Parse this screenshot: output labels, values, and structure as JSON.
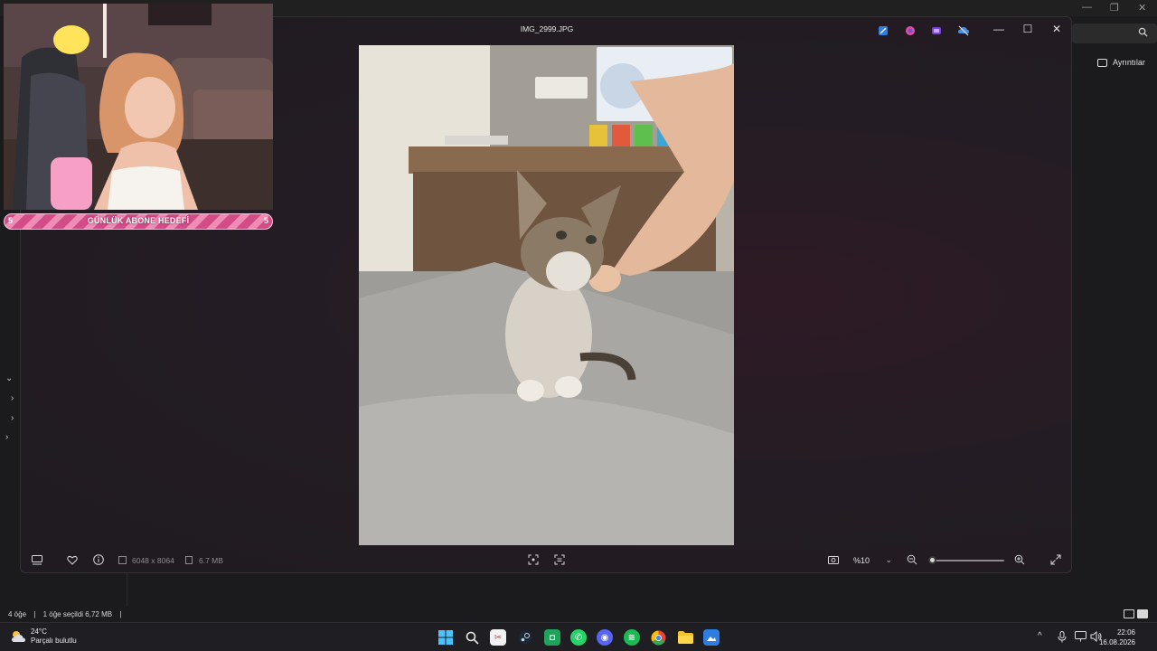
{
  "explorer": {
    "window_controls": {
      "minimize": "—",
      "maximize": "❐",
      "close": "✕"
    },
    "search_icon": "search-icon",
    "details_label": "Ayrıntılar",
    "nav_chevrons": [
      "⌄",
      "›",
      "›",
      "›"
    ],
    "status": {
      "item_count": "4 öğe",
      "separator": "|",
      "selected": "1 öğe seçildi  6,72 MB",
      "end_separator": "|"
    }
  },
  "photos": {
    "title": "IMG_2999.JPG",
    "window_controls": {
      "minimize": "—",
      "maximize": "☐",
      "close": "✕"
    },
    "toolbar": {
      "dimensions": "6048 x 8064",
      "file_size": "6.7 MB",
      "zoom": "%10",
      "zoom_chevron": "⌄",
      "zoom_level": 0.02
    }
  },
  "webcam": {
    "goal_label": "GÜNLÜK ABONE HEDEFİ",
    "goal_current": "5",
    "goal_target": "5"
  },
  "taskbar": {
    "weather": {
      "temp": "24°C",
      "condition": "Parçalı bulutlu"
    },
    "clock": {
      "time": "22:06",
      "date": "16.08.2026"
    },
    "tray_chevron": "^"
  },
  "colors": {
    "accent_pink": "#d24c86",
    "taskbar_bg": "#1f1e22",
    "photos_bg": "#241c24"
  }
}
